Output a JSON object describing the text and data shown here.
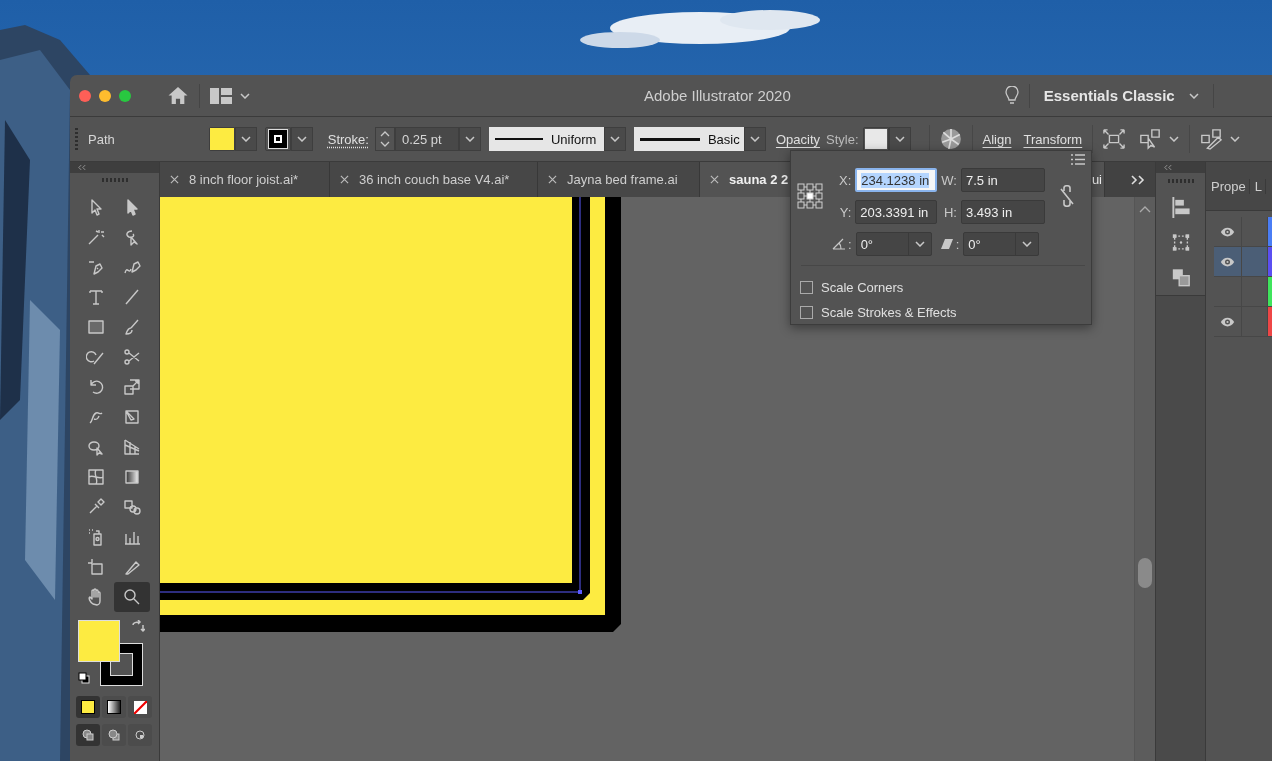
{
  "window": {
    "title": "Adobe Illustrator 2020"
  },
  "workspace": {
    "label": "Essentials Classic"
  },
  "control_bar": {
    "selection": "Path",
    "stroke_label": "Stroke:",
    "stroke_weight": "0.25 pt",
    "profile": "Uniform",
    "brush": "Basic",
    "opacity_label": "Opacity",
    "style_label": "Style:",
    "align_label": "Align",
    "transform_label": "Transform"
  },
  "document_tabs": [
    {
      "label": "8 inch floor joist.ai*",
      "selected": false
    },
    {
      "label": "36 inch couch base V4.ai*",
      "selected": false
    },
    {
      "label": "Jayna bed frame.ai",
      "selected": false
    },
    {
      "label": "sauna 2 2",
      "label_tail": "ui",
      "selected": true
    }
  ],
  "tools": [
    {
      "selected": false
    },
    {
      "selected": false
    },
    {
      "selected": false
    },
    {
      "selected": false
    },
    {
      "selected": false
    },
    {
      "selected": false
    },
    {
      "selected": false
    },
    {
      "selected": false
    },
    {
      "selected": false
    },
    {
      "selected": false
    },
    {
      "selected": false
    },
    {
      "selected": false
    },
    {
      "selected": false
    },
    {
      "selected": false
    },
    {
      "selected": false
    },
    {
      "selected": false
    },
    {
      "selected": false
    },
    {
      "selected": false
    },
    {
      "selected": false
    },
    {
      "selected": false
    },
    {
      "selected": false
    },
    {
      "selected": false
    },
    {
      "selected": false
    },
    {
      "selected": false
    },
    {
      "selected": false
    },
    {
      "selected": false
    },
    {
      "selected": false
    },
    {
      "selected": true
    }
  ],
  "transform_popup": {
    "fields": [
      {
        "label": "X:",
        "value": "234.1238 in",
        "focused": true
      },
      {
        "label": "W:",
        "value": "7.5 in",
        "focused": false
      },
      {
        "label": "Y:",
        "value": "203.3391 in",
        "focused": false
      },
      {
        "label": "H:",
        "value": "3.493 in",
        "focused": false
      }
    ],
    "constrain": false,
    "dropdowns": [
      {
        "kind": "rotate",
        "label": ":",
        "value": "0°"
      },
      {
        "kind": "shear",
        "label": ":",
        "value": "0°"
      }
    ],
    "options": [
      {
        "label": "Scale Corners",
        "checked": false
      },
      {
        "label": "Scale Strokes & Effects",
        "checked": false
      }
    ]
  },
  "layers_panel": {
    "tabs": [
      "Prope",
      "L"
    ],
    "rows": [
      {
        "visible": true,
        "selected": false,
        "color": "#4a7df5"
      },
      {
        "visible": true,
        "selected": true,
        "color": "#5b4ff2"
      },
      {
        "visible": false,
        "selected": false,
        "color": "#3fe45c"
      },
      {
        "visible": true,
        "selected": false,
        "color": "#ee4646"
      }
    ]
  }
}
